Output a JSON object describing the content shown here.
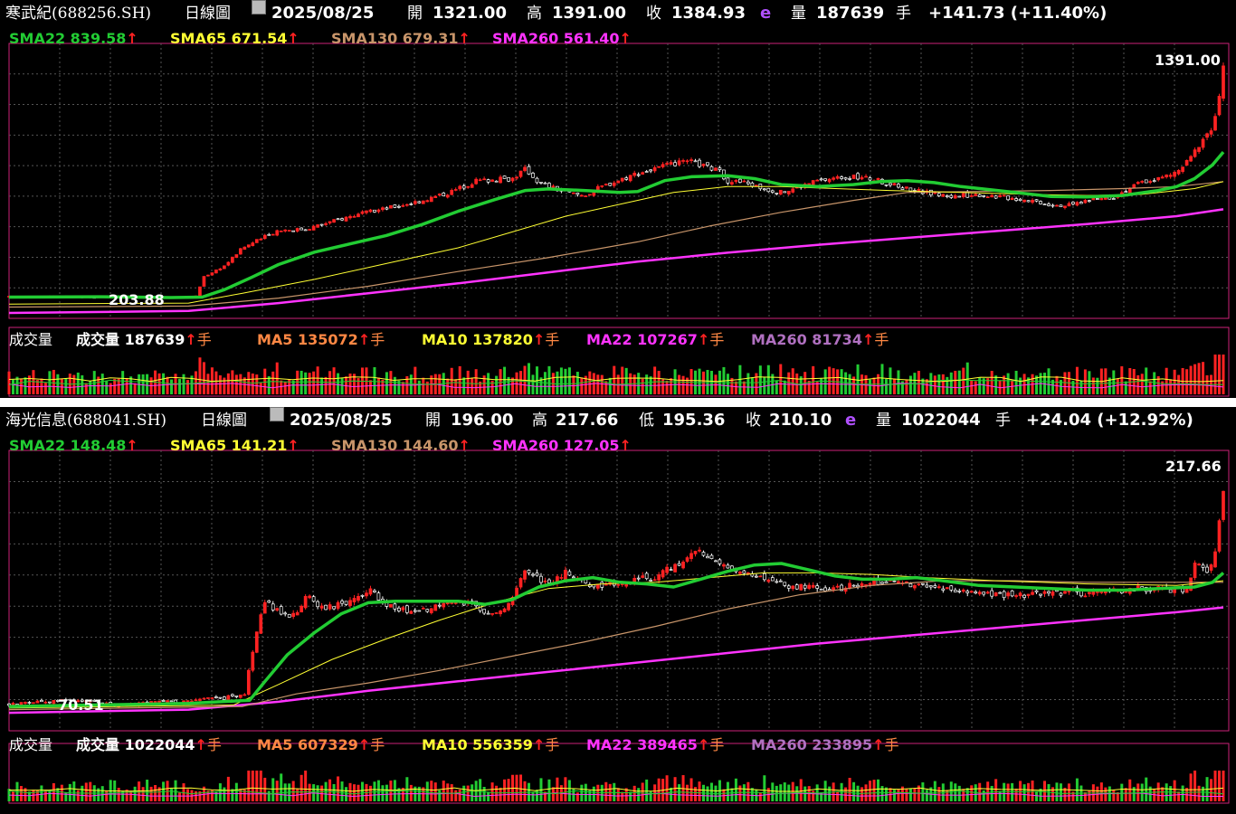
{
  "colors": {
    "sma22": "#22cc33",
    "sma65": "#ffff33",
    "sma130": "#c8956a",
    "sma260": "#ff33ff",
    "up": "#ff2222",
    "down": "#22cc33",
    "grid": "#555555",
    "frame": "#cc2277"
  },
  "arrow": "↑",
  "chart_data": [
    {
      "type": "candlestick",
      "header": {
        "name": "寒武紀(688256.SH)",
        "period": "日線圖",
        "date": "2025/08/25",
        "open_label": "開",
        "open": "1321.00",
        "high_label": "高",
        "high": "1391.00",
        "close_label": "收",
        "close": "1384.93",
        "estimate_flag": "e",
        "volume_label": "量",
        "volume": "187639",
        "volume_unit": "手",
        "change": "+141.73 (+11.40%)"
      },
      "ma_legend": [
        {
          "name": "SMA22",
          "value": "839.58",
          "color": "#22cc33"
        },
        {
          "name": "SMA65",
          "value": "671.54",
          "color": "#ffff33"
        },
        {
          "name": "SMA130",
          "value": "679.31",
          "color": "#c8956a"
        },
        {
          "name": "SMA260",
          "value": "561.40",
          "color": "#ff33ff"
        }
      ],
      "max_label": "1391.00",
      "min_label": "203.88",
      "volume_panel": {
        "title": "成交量",
        "items": [
          {
            "name": "成交量",
            "value": "187639",
            "color": "#ffffff"
          },
          {
            "name": "MA5",
            "value": "135072",
            "color": "#ff8844"
          },
          {
            "name": "MA10",
            "value": "137820",
            "color": "#ffff33"
          },
          {
            "name": "MA22",
            "value": "107267",
            "color": "#ff33ff"
          },
          {
            "name": "MA260",
            "value": "81734",
            "color": "#b070c0"
          }
        ],
        "unit": "手"
      },
      "y_range": [
        150,
        1460
      ],
      "close_path": [
        [
          0,
          232
        ],
        [
          40,
          235
        ],
        [
          80,
          229
        ],
        [
          120,
          232
        ],
        [
          155,
          226
        ],
        [
          175,
          233
        ],
        [
          200,
          226
        ],
        [
          210,
          236
        ],
        [
          215,
          330
        ],
        [
          240,
          390
        ],
        [
          260,
          480
        ],
        [
          300,
          570
        ],
        [
          330,
          575
        ],
        [
          380,
          640
        ],
        [
          420,
          680
        ],
        [
          460,
          720
        ],
        [
          490,
          760
        ],
        [
          520,
          820
        ],
        [
          560,
          830
        ],
        [
          575,
          880
        ],
        [
          590,
          810
        ],
        [
          620,
          760
        ],
        [
          640,
          745
        ],
        [
          660,
          790
        ],
        [
          700,
          860
        ],
        [
          720,
          880
        ],
        [
          740,
          905
        ],
        [
          760,
          915
        ],
        [
          790,
          870
        ],
        [
          800,
          820
        ],
        [
          820,
          810
        ],
        [
          840,
          780
        ],
        [
          860,
          760
        ],
        [
          880,
          790
        ],
        [
          900,
          820
        ],
        [
          930,
          840
        ],
        [
          960,
          830
        ],
        [
          990,
          790
        ],
        [
          1020,
          760
        ],
        [
          1050,
          740
        ],
        [
          1080,
          750
        ],
        [
          1110,
          735
        ],
        [
          1140,
          720
        ],
        [
          1160,
          700
        ],
        [
          1180,
          695
        ],
        [
          1200,
          720
        ],
        [
          1230,
          740
        ],
        [
          1260,
          810
        ],
        [
          1280,
          830
        ],
        [
          1300,
          860
        ],
        [
          1315,
          930
        ],
        [
          1330,
          1040
        ],
        [
          1339,
          1080
        ],
        [
          1347,
          1220
        ],
        [
          1352,
          1384.93
        ]
      ],
      "sma22_path": [
        [
          0,
          230
        ],
        [
          100,
          232
        ],
        [
          180,
          228
        ],
        [
          215,
          230
        ],
        [
          240,
          268
        ],
        [
          270,
          330
        ],
        [
          300,
          395
        ],
        [
          340,
          458
        ],
        [
          380,
          500
        ],
        [
          420,
          542
        ],
        [
          460,
          598
        ],
        [
          500,
          665
        ],
        [
          540,
          723
        ],
        [
          575,
          770
        ],
        [
          600,
          778
        ],
        [
          640,
          770
        ],
        [
          680,
          760
        ],
        [
          700,
          765
        ],
        [
          730,
          820
        ],
        [
          760,
          840
        ],
        [
          800,
          845
        ],
        [
          830,
          830
        ],
        [
          860,
          800
        ],
        [
          900,
          790
        ],
        [
          940,
          800
        ],
        [
          970,
          815
        ],
        [
          1000,
          820
        ],
        [
          1030,
          810
        ],
        [
          1060,
          790
        ],
        [
          1090,
          775
        ],
        [
          1120,
          760
        ],
        [
          1160,
          740
        ],
        [
          1200,
          737
        ],
        [
          1240,
          745
        ],
        [
          1280,
          770
        ],
        [
          1300,
          790
        ],
        [
          1320,
          830
        ],
        [
          1340,
          900
        ],
        [
          1352,
          965
        ]
      ],
      "sma65_path": [
        [
          0,
          195
        ],
        [
          200,
          200
        ],
        [
          260,
          250
        ],
        [
          340,
          320
        ],
        [
          420,
          400
        ],
        [
          500,
          480
        ],
        [
          560,
          560
        ],
        [
          620,
          640
        ],
        [
          680,
          700
        ],
        [
          740,
          760
        ],
        [
          800,
          790
        ],
        [
          860,
          790
        ],
        [
          920,
          780
        ],
        [
          980,
          770
        ],
        [
          1060,
          760
        ],
        [
          1140,
          750
        ],
        [
          1200,
          745
        ],
        [
          1260,
          750
        ],
        [
          1320,
          780
        ],
        [
          1352,
          815
        ]
      ],
      "sma130_path": [
        [
          0,
          180
        ],
        [
          200,
          185
        ],
        [
          300,
          225
        ],
        [
          400,
          285
        ],
        [
          500,
          360
        ],
        [
          600,
          430
        ],
        [
          700,
          510
        ],
        [
          780,
          590
        ],
        [
          860,
          660
        ],
        [
          940,
          720
        ],
        [
          1000,
          760
        ],
        [
          1080,
          765
        ],
        [
          1160,
          770
        ],
        [
          1240,
          780
        ],
        [
          1300,
          790
        ],
        [
          1352,
          815
        ]
      ],
      "sma260_path": [
        [
          0,
          150
        ],
        [
          200,
          160
        ],
        [
          300,
          200
        ],
        [
          400,
          250
        ],
        [
          500,
          300
        ],
        [
          600,
          355
        ],
        [
          700,
          410
        ],
        [
          800,
          455
        ],
        [
          900,
          495
        ],
        [
          1000,
          530
        ],
        [
          1100,
          565
        ],
        [
          1200,
          600
        ],
        [
          1300,
          640
        ],
        [
          1352,
          675
        ]
      ]
    },
    {
      "type": "candlestick",
      "header": {
        "name": "海光信息(688041.SH)",
        "period": "日線圖",
        "date": "2025/08/25",
        "open_label": "開",
        "open": "196.00",
        "high_label": "高",
        "high": "217.66",
        "low_label": "低",
        "low": "195.36",
        "close_label": "收",
        "close": "210.10",
        "estimate_flag": "e",
        "volume_label": "量",
        "volume": "1022044",
        "volume_unit": "手",
        "change": "+24.04 (+12.92%)"
      },
      "ma_legend": [
        {
          "name": "SMA22",
          "value": "148.48",
          "color": "#22cc33"
        },
        {
          "name": "SMA65",
          "value": "141.21",
          "color": "#ffff33"
        },
        {
          "name": "SMA130",
          "value": "144.60",
          "color": "#c8956a"
        },
        {
          "name": "SMA260",
          "value": "127.05",
          "color": "#ff33ff"
        }
      ],
      "max_label": "217.66",
      "min_label": "70.51",
      "volume_panel": {
        "title": "成交量",
        "items": [
          {
            "name": "成交量",
            "value": "1022044",
            "color": "#ffffff"
          },
          {
            "name": "MA5",
            "value": "607329",
            "color": "#ff8844"
          },
          {
            "name": "MA10",
            "value": "556359",
            "color": "#ffff33"
          },
          {
            "name": "MA22",
            "value": "389465",
            "color": "#ff33ff"
          },
          {
            "name": "MA260",
            "value": "233895",
            "color": "#b070c0"
          }
        ],
        "unit": "手"
      },
      "y_range": [
        60,
        228
      ],
      "close_path": [
        [
          0,
          73
        ],
        [
          60,
          76
        ],
        [
          120,
          73
        ],
        [
          180,
          75
        ],
        [
          230,
          77
        ],
        [
          262,
          79
        ],
        [
          272,
          110
        ],
        [
          285,
          140
        ],
        [
          300,
          132
        ],
        [
          315,
          128
        ],
        [
          330,
          142
        ],
        [
          350,
          135
        ],
        [
          380,
          138
        ],
        [
          400,
          146
        ],
        [
          420,
          137
        ],
        [
          450,
          132
        ],
        [
          480,
          136
        ],
        [
          510,
          138
        ],
        [
          540,
          130
        ],
        [
          560,
          140
        ],
        [
          575,
          160
        ],
        [
          600,
          150
        ],
        [
          620,
          158
        ],
        [
          640,
          150
        ],
        [
          660,
          148
        ],
        [
          690,
          152
        ],
        [
          720,
          154
        ],
        [
          750,
          165
        ],
        [
          770,
          170
        ],
        [
          800,
          160
        ],
        [
          830,
          155
        ],
        [
          860,
          150
        ],
        [
          890,
          148
        ],
        [
          910,
          145
        ],
        [
          940,
          150
        ],
        [
          970,
          152
        ],
        [
          1000,
          150
        ],
        [
          1040,
          146
        ],
        [
          1080,
          144
        ],
        [
          1120,
          142
        ],
        [
          1160,
          145
        ],
        [
          1200,
          144
        ],
        [
          1240,
          146
        ],
        [
          1280,
          148
        ],
        [
          1310,
          145
        ],
        [
          1320,
          162
        ],
        [
          1335,
          158
        ],
        [
          1345,
          175
        ],
        [
          1352,
          210.1
        ]
      ],
      "sma22_path": [
        [
          0,
          72
        ],
        [
          100,
          73
        ],
        [
          200,
          74
        ],
        [
          268,
          76
        ],
        [
          285,
          88
        ],
        [
          310,
          105
        ],
        [
          340,
          119
        ],
        [
          370,
          131
        ],
        [
          400,
          138
        ],
        [
          430,
          139
        ],
        [
          470,
          139
        ],
        [
          500,
          139
        ],
        [
          530,
          137
        ],
        [
          560,
          140
        ],
        [
          590,
          148
        ],
        [
          620,
          152
        ],
        [
          650,
          154
        ],
        [
          680,
          151
        ],
        [
          710,
          150
        ],
        [
          740,
          148
        ],
        [
          770,
          153
        ],
        [
          800,
          158
        ],
        [
          830,
          162
        ],
        [
          860,
          163
        ],
        [
          890,
          159
        ],
        [
          920,
          155
        ],
        [
          950,
          153
        ],
        [
          980,
          153
        ],
        [
          1010,
          154
        ],
        [
          1040,
          152
        ],
        [
          1080,
          149
        ],
        [
          1120,
          148
        ],
        [
          1160,
          147
        ],
        [
          1200,
          146
        ],
        [
          1240,
          146
        ],
        [
          1280,
          147
        ],
        [
          1320,
          148
        ],
        [
          1340,
          151
        ],
        [
          1352,
          157
        ]
      ],
      "sma65_path": [
        [
          0,
          71
        ],
        [
          250,
          73
        ],
        [
          300,
          86
        ],
        [
          360,
          102
        ],
        [
          420,
          115
        ],
        [
          480,
          127
        ],
        [
          540,
          138
        ],
        [
          600,
          147
        ],
        [
          660,
          150
        ],
        [
          720,
          151
        ],
        [
          780,
          154
        ],
        [
          840,
          157
        ],
        [
          900,
          157
        ],
        [
          960,
          156
        ],
        [
          1020,
          154
        ],
        [
          1100,
          152
        ],
        [
          1200,
          150
        ],
        [
          1300,
          149
        ],
        [
          1352,
          152
        ]
      ],
      "sma130_path": [
        [
          0,
          70
        ],
        [
          260,
          72
        ],
        [
          320,
          80
        ],
        [
          400,
          87
        ],
        [
          480,
          95
        ],
        [
          560,
          104
        ],
        [
          640,
          113
        ],
        [
          720,
          123
        ],
        [
          800,
          134
        ],
        [
          880,
          143
        ],
        [
          960,
          149
        ],
        [
          1040,
          152
        ],
        [
          1120,
          152
        ],
        [
          1200,
          151
        ],
        [
          1280,
          151
        ],
        [
          1352,
          151
        ]
      ],
      "sma260_path": [
        [
          0,
          68
        ],
        [
          200,
          70
        ],
        [
          300,
          75
        ],
        [
          400,
          82
        ],
        [
          500,
          88
        ],
        [
          600,
          94
        ],
        [
          700,
          100
        ],
        [
          800,
          106
        ],
        [
          900,
          112
        ],
        [
          1000,
          117
        ],
        [
          1100,
          122
        ],
        [
          1200,
          127
        ],
        [
          1300,
          132
        ],
        [
          1352,
          135
        ]
      ]
    }
  ]
}
